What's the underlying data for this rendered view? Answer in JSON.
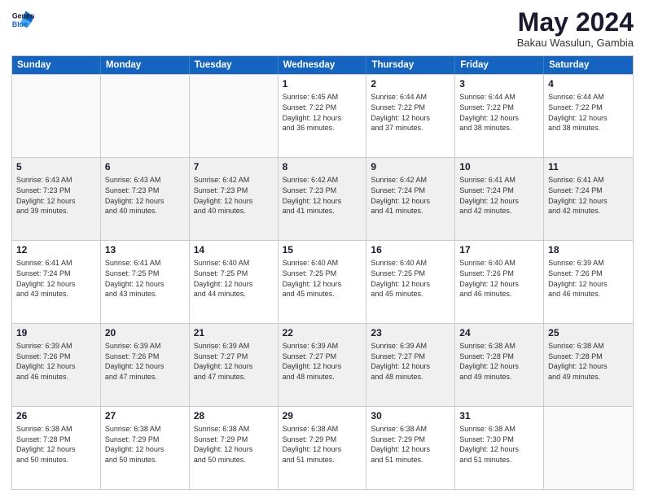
{
  "header": {
    "logo_line1": "General",
    "logo_line2": "Blue",
    "month": "May 2024",
    "location": "Bakau Wasulun, Gambia"
  },
  "days": [
    "Sunday",
    "Monday",
    "Tuesday",
    "Wednesday",
    "Thursday",
    "Friday",
    "Saturday"
  ],
  "weeks": [
    [
      {
        "num": "",
        "info": ""
      },
      {
        "num": "",
        "info": ""
      },
      {
        "num": "",
        "info": ""
      },
      {
        "num": "1",
        "info": "Sunrise: 6:45 AM\nSunset: 7:22 PM\nDaylight: 12 hours\nand 36 minutes."
      },
      {
        "num": "2",
        "info": "Sunrise: 6:44 AM\nSunset: 7:22 PM\nDaylight: 12 hours\nand 37 minutes."
      },
      {
        "num": "3",
        "info": "Sunrise: 6:44 AM\nSunset: 7:22 PM\nDaylight: 12 hours\nand 38 minutes."
      },
      {
        "num": "4",
        "info": "Sunrise: 6:44 AM\nSunset: 7:22 PM\nDaylight: 12 hours\nand 38 minutes."
      }
    ],
    [
      {
        "num": "5",
        "info": "Sunrise: 6:43 AM\nSunset: 7:23 PM\nDaylight: 12 hours\nand 39 minutes."
      },
      {
        "num": "6",
        "info": "Sunrise: 6:43 AM\nSunset: 7:23 PM\nDaylight: 12 hours\nand 40 minutes."
      },
      {
        "num": "7",
        "info": "Sunrise: 6:42 AM\nSunset: 7:23 PM\nDaylight: 12 hours\nand 40 minutes."
      },
      {
        "num": "8",
        "info": "Sunrise: 6:42 AM\nSunset: 7:23 PM\nDaylight: 12 hours\nand 41 minutes."
      },
      {
        "num": "9",
        "info": "Sunrise: 6:42 AM\nSunset: 7:24 PM\nDaylight: 12 hours\nand 41 minutes."
      },
      {
        "num": "10",
        "info": "Sunrise: 6:41 AM\nSunset: 7:24 PM\nDaylight: 12 hours\nand 42 minutes."
      },
      {
        "num": "11",
        "info": "Sunrise: 6:41 AM\nSunset: 7:24 PM\nDaylight: 12 hours\nand 42 minutes."
      }
    ],
    [
      {
        "num": "12",
        "info": "Sunrise: 6:41 AM\nSunset: 7:24 PM\nDaylight: 12 hours\nand 43 minutes."
      },
      {
        "num": "13",
        "info": "Sunrise: 6:41 AM\nSunset: 7:25 PM\nDaylight: 12 hours\nand 43 minutes."
      },
      {
        "num": "14",
        "info": "Sunrise: 6:40 AM\nSunset: 7:25 PM\nDaylight: 12 hours\nand 44 minutes."
      },
      {
        "num": "15",
        "info": "Sunrise: 6:40 AM\nSunset: 7:25 PM\nDaylight: 12 hours\nand 45 minutes."
      },
      {
        "num": "16",
        "info": "Sunrise: 6:40 AM\nSunset: 7:25 PM\nDaylight: 12 hours\nand 45 minutes."
      },
      {
        "num": "17",
        "info": "Sunrise: 6:40 AM\nSunset: 7:26 PM\nDaylight: 12 hours\nand 46 minutes."
      },
      {
        "num": "18",
        "info": "Sunrise: 6:39 AM\nSunset: 7:26 PM\nDaylight: 12 hours\nand 46 minutes."
      }
    ],
    [
      {
        "num": "19",
        "info": "Sunrise: 6:39 AM\nSunset: 7:26 PM\nDaylight: 12 hours\nand 46 minutes."
      },
      {
        "num": "20",
        "info": "Sunrise: 6:39 AM\nSunset: 7:26 PM\nDaylight: 12 hours\nand 47 minutes."
      },
      {
        "num": "21",
        "info": "Sunrise: 6:39 AM\nSunset: 7:27 PM\nDaylight: 12 hours\nand 47 minutes."
      },
      {
        "num": "22",
        "info": "Sunrise: 6:39 AM\nSunset: 7:27 PM\nDaylight: 12 hours\nand 48 minutes."
      },
      {
        "num": "23",
        "info": "Sunrise: 6:39 AM\nSunset: 7:27 PM\nDaylight: 12 hours\nand 48 minutes."
      },
      {
        "num": "24",
        "info": "Sunrise: 6:38 AM\nSunset: 7:28 PM\nDaylight: 12 hours\nand 49 minutes."
      },
      {
        "num": "25",
        "info": "Sunrise: 6:38 AM\nSunset: 7:28 PM\nDaylight: 12 hours\nand 49 minutes."
      }
    ],
    [
      {
        "num": "26",
        "info": "Sunrise: 6:38 AM\nSunset: 7:28 PM\nDaylight: 12 hours\nand 50 minutes."
      },
      {
        "num": "27",
        "info": "Sunrise: 6:38 AM\nSunset: 7:29 PM\nDaylight: 12 hours\nand 50 minutes."
      },
      {
        "num": "28",
        "info": "Sunrise: 6:38 AM\nSunset: 7:29 PM\nDaylight: 12 hours\nand 50 minutes."
      },
      {
        "num": "29",
        "info": "Sunrise: 6:38 AM\nSunset: 7:29 PM\nDaylight: 12 hours\nand 51 minutes."
      },
      {
        "num": "30",
        "info": "Sunrise: 6:38 AM\nSunset: 7:29 PM\nDaylight: 12 hours\nand 51 minutes."
      },
      {
        "num": "31",
        "info": "Sunrise: 6:38 AM\nSunset: 7:30 PM\nDaylight: 12 hours\nand 51 minutes."
      },
      {
        "num": "",
        "info": ""
      }
    ]
  ]
}
